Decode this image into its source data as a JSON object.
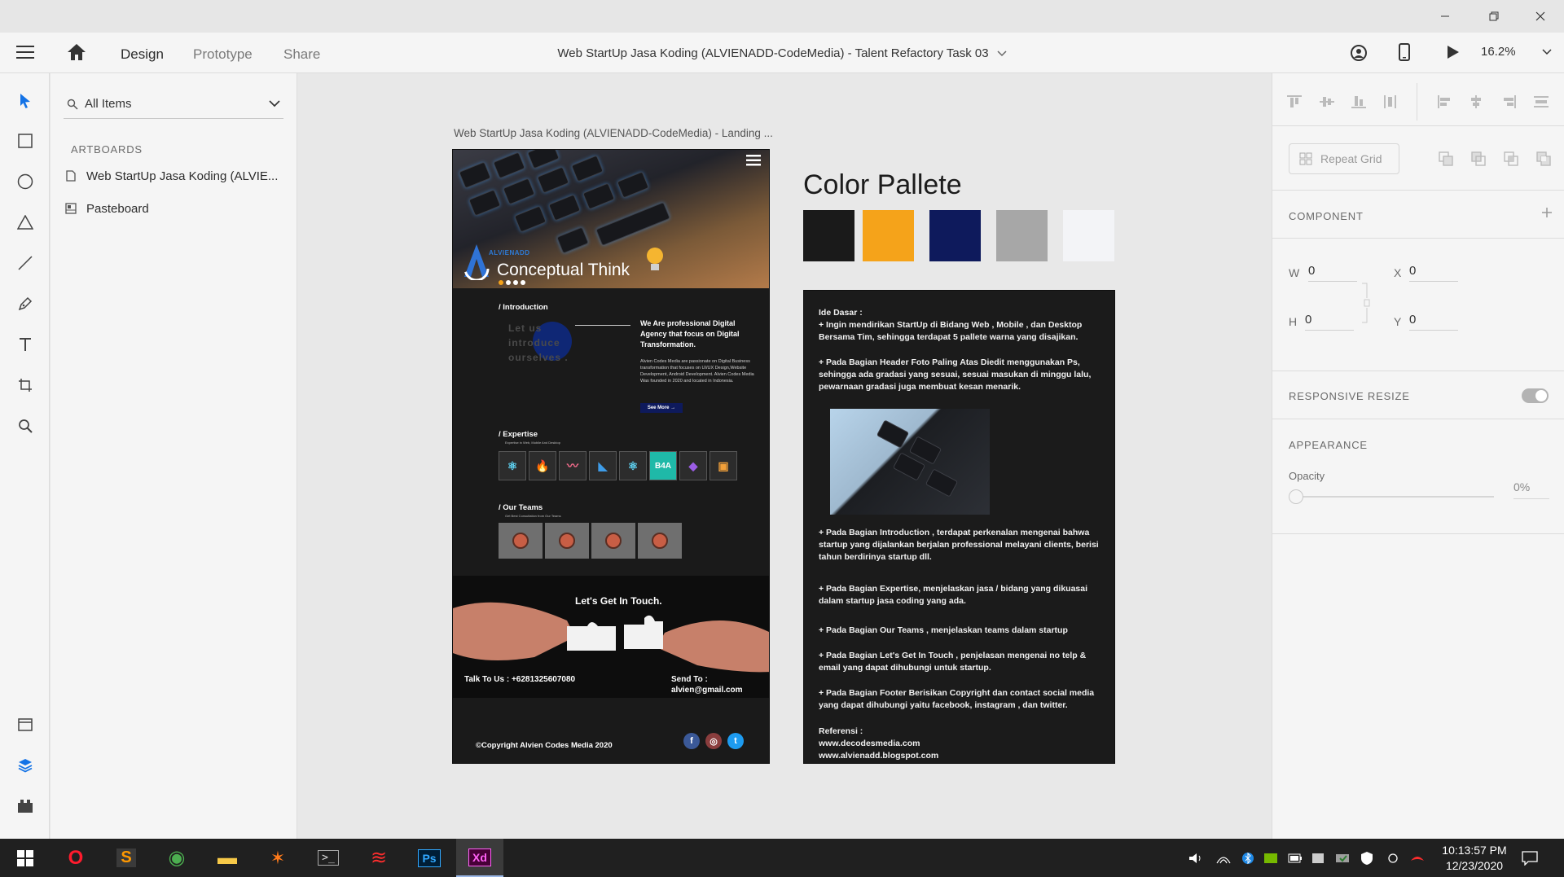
{
  "app": {
    "document_title": "Web StartUp Jasa Koding (ALVIENADD-CodeMedia) - Talent Refactory Task 03",
    "zoom": "16.2%"
  },
  "tabs": [
    {
      "label": "Design",
      "active": true
    },
    {
      "label": "Prototype",
      "active": false
    },
    {
      "label": "Share",
      "active": false
    }
  ],
  "layers_panel": {
    "filter_label": "All Items",
    "section_label": "ARTBOARDS",
    "items": [
      {
        "label": "Web StartUp Jasa Koding (ALVIE...",
        "icon": "artboard-icon"
      },
      {
        "label": "Pasteboard",
        "icon": "pasteboard-icon"
      }
    ]
  },
  "canvas": {
    "artboard_label": "Web StartUp Jasa Koding (ALVIENADD-CodeMedia) - Landing ...",
    "artboard": {
      "hero_brand": "ALVIENADD",
      "hero_title": "Conceptual Think",
      "intro_heading": "/ Introduction",
      "intro_lines": [
        "Let us",
        "introduce",
        "ourselves ."
      ],
      "agency_heading": "We Are professional Digital Agency that focus on Digital Transformation.",
      "agency_body": "Alvien Codes Media are passionate on Digital Business transformation that focuses on UI/UX Design,Website Development, Android Development. Alvien Codes Media Was founded in 2020 and located in Indonesia.",
      "see_more": "See More →",
      "expertise_heading": "/ Expertise",
      "expertise_sub": "Expertise in Web, Mobile And Desktop",
      "expertise_tiles": [
        {
          "glyph": "⚛",
          "color": "#61dafb"
        },
        {
          "glyph": "🔥",
          "color": "#e06b3a"
        },
        {
          "glyph": "〰",
          "color": "#f06b8a"
        },
        {
          "glyph": "◣",
          "color": "#3e9ce8"
        },
        {
          "glyph": "⚛",
          "color": "#61dafb"
        },
        {
          "glyph": "B4A",
          "color": "#ffffff"
        },
        {
          "glyph": "◆",
          "color": "#9b5de5"
        },
        {
          "glyph": "▣",
          "color": "#f2a03a"
        }
      ],
      "teams_heading": "/ Our Teams",
      "teams_sub": "Get Best Consultation from Our Teams",
      "contact_heading": "Let's Get In Touch.",
      "talk_to_us": "Talk To Us : +6281325607080",
      "send_to_label": "Send To :",
      "send_to_email": "alvien@gmail.com",
      "copyright": "©Copyright Alvien Codes Media 2020"
    },
    "palette_title": "Color Pallete",
    "palette": [
      "#1a1a1a",
      "#f5a31a",
      "#0e1a5c",
      "#a7a7a7",
      "#f3f4f7"
    ],
    "notes": {
      "heading": "Ide Dasar :",
      "points": [
        "+ Ingin mendirikan StartUp di Bidang Web , Mobile , dan Desktop Bersama Tim, sehingga terdapat 5 pallete warna yang disajikan.",
        "+ Pada Bagian Header Foto Paling Atas Diedit menggunakan Ps, sehingga ada gradasi yang sesuai, sesuai masukan di minggu lalu, pewarnaan gradasi juga membuat kesan menarik.",
        "+ Pada Bagian Introduction , terdapat perkenalan mengenai bahwa startup yang dijalankan berjalan professional melayani clients, berisi tahun berdirinya startup dll.",
        "+ Pada Bagian Expertise, menjelaskan jasa / bidang yang dikuasai dalam startup jasa coding yang ada.",
        "+ Pada Bagian Our Teams , menjelaskan teams dalam startup",
        "+ Pada Bagian Let's Get In Touch , penjelasan mengenai no telp & email yang dapat dihubungi untuk startup.",
        "+ Pada Bagian Footer Berisikan Copyright dan contact social media yang dapat dihubungi yaitu facebook, instagram , dan twitter."
      ],
      "reference_label": "Referensi :",
      "references": [
        "www.decodesmedia.com",
        "www.alvienadd.blogspot.com"
      ]
    }
  },
  "properties": {
    "repeat_grid": "Repeat Grid",
    "component_label": "COMPONENT",
    "w_label": "W",
    "w_value": "0",
    "x_label": "X",
    "x_value": "0",
    "h_label": "H",
    "h_value": "0",
    "y_label": "Y",
    "y_value": "0",
    "responsive_label": "RESPONSIVE RESIZE",
    "appearance_label": "APPEARANCE",
    "opacity_label": "Opacity",
    "opacity_value": "0%"
  },
  "taskbar": {
    "time": "10:13:57 PM",
    "date": "12/23/2020",
    "apps": [
      {
        "name": "opera-icon",
        "glyph": "O",
        "color": "#ff1b2d"
      },
      {
        "name": "sublime-icon",
        "glyph": "S",
        "color": "#ff9800"
      },
      {
        "name": "chrome-icon",
        "glyph": "◉",
        "color": "#4caf50"
      },
      {
        "name": "file-explorer-icon",
        "glyph": "▬",
        "color": "#f7c948"
      },
      {
        "name": "butterfly-app-icon",
        "glyph": "✶",
        "color": "#ff7a1a"
      },
      {
        "name": "terminal-icon",
        "glyph": ">_",
        "color": "#dddddd"
      },
      {
        "name": "razer-icon",
        "glyph": "≋",
        "color": "#ff2d2d"
      },
      {
        "name": "photoshop-icon",
        "glyph": "Ps",
        "color": "#31a8ff"
      },
      {
        "name": "adobe-xd-icon",
        "glyph": "Xd",
        "color": "#ff61f6"
      }
    ]
  }
}
